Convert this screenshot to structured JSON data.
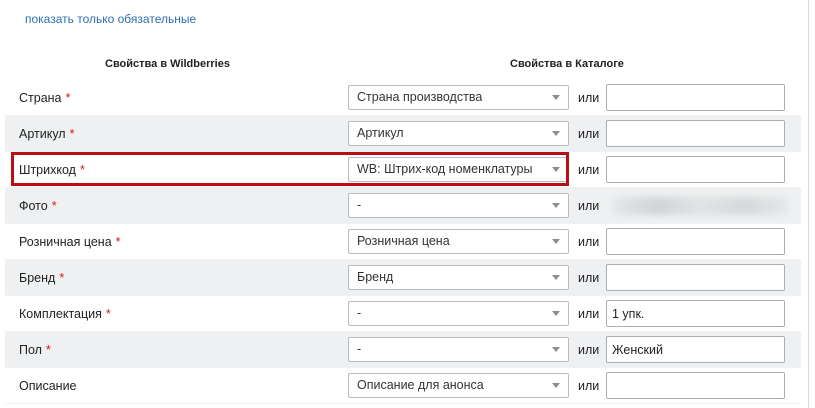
{
  "show_required_link": "показать только обязательные",
  "headers": {
    "wb": "Свойства в Wildberries",
    "catalog": "Свойства в Каталоге"
  },
  "or_label": "или",
  "required_mark": "*",
  "rows": [
    {
      "label": "Страна",
      "required": true,
      "select": "Страна производства",
      "input": ""
    },
    {
      "label": "Артикул",
      "required": true,
      "select": "Артикул",
      "input": ""
    },
    {
      "label": "Штрихкод",
      "required": true,
      "select": "WB: Штрих-код номенклатуры",
      "input": "",
      "highlighted": true
    },
    {
      "label": "Фото",
      "required": true,
      "select": "-",
      "input_blurred": true
    },
    {
      "label": "Розничная цена",
      "required": true,
      "select": "Розничная цена",
      "input": ""
    },
    {
      "label": "Бренд",
      "required": true,
      "select": "Бренд",
      "input": ""
    },
    {
      "label": "Комплектация",
      "required": true,
      "select": "-",
      "input": "1 упк."
    },
    {
      "label": "Пол",
      "required": true,
      "select": "-",
      "input": "Женский"
    },
    {
      "label": "Описание",
      "required": false,
      "select": "Описание для анонса",
      "input": ""
    }
  ],
  "colors": {
    "link": "#2f6fb3",
    "required": "#d01c1c",
    "highlight": "#b80f14",
    "alt_row": "#eef0f1"
  }
}
